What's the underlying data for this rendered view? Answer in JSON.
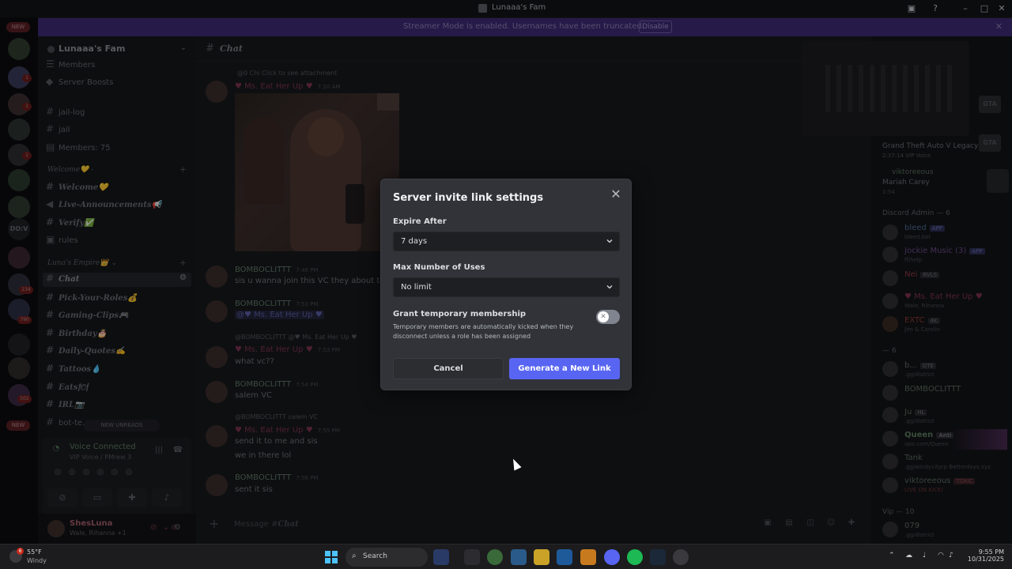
{
  "window": {
    "title": "Lunaaa's Fam"
  },
  "banner": {
    "text": "Streamer Mode is enabled. Usernames have been truncated.",
    "disable_label": "Disable"
  },
  "rail": {
    "new_top": "NEW",
    "new_bottom": "NEW",
    "badges": [
      "1",
      "1",
      "1",
      "234",
      "790",
      "502",
      "1"
    ],
    "dov_label": "DO:V"
  },
  "sidebar": {
    "guild_name": "Lunaaa's Fam",
    "items_top": [
      {
        "label": "Members"
      },
      {
        "label": "Server Boosts"
      }
    ],
    "channels_a": [
      "jail-log",
      "jail",
      "Members: 75"
    ],
    "category_welcome": "Welcome💛 -",
    "channels_welcome": [
      "Welcome💛",
      "Live-Announcements📢",
      "Verify✅",
      "rules"
    ],
    "category_empire": "Luna's Empire👑 ⌄",
    "active_channel": "Chat",
    "channels_empire": [
      "Pick-Your-Roles💰",
      "Gaming-Clips🎮",
      "Birthday🎂",
      "Daily-Quotes✍",
      "Tattoos💧",
      "Eats🍽",
      "IRL📷",
      "bot-te..."
    ],
    "new_unreads": "NEW UNREADS"
  },
  "voice": {
    "status": "Voice Connected",
    "channel": "VIP Voice / PMrew 3"
  },
  "user": {
    "name": "ShesLuna",
    "sub": "Wale, Rihanna +1"
  },
  "chat": {
    "channel": "Chat",
    "msg1_reply": "@0  Chi  Click to see attachment",
    "msg1_author": "♥ Ms. Eat Her Up ♥",
    "msg1_time": "7:20 AM",
    "msg2_author": "BOMBOCLITTT",
    "msg2_time": "7:46 PM",
    "msg2_text": "sis u wanna join this VC they about to dri",
    "msg3_author": "BOMBOCLITTT",
    "msg3_time": "7:53 PM",
    "msg3_mention": "@♥ Ms. Eat Her Up ♥",
    "msg4_reply": "@BOMBOCLITTT  @♥ Ms. Eat Her Up ♥",
    "msg4_author": "♥ Ms. Eat Her Up ♥",
    "msg4_time": "7:53 PM",
    "msg4_text": "what vc??",
    "msg5_author": "BOMBOCLITTT",
    "msg5_time": "7:54 PM",
    "msg5_text": "salem VC",
    "msg6_reply": "@BOMBOCLITTT  salem VC",
    "msg6_author": "♥ Ms. Eat Her Up ♥",
    "msg6_time": "7:55 PM",
    "msg6_text1": "send it to me and sis",
    "msg6_text2": "we in there lol",
    "msg7_author": "BOMBOCLITTT",
    "msg7_time": "7:56 PM",
    "msg7_text": "sent it sis",
    "composer_prefix": "Message #",
    "composer_channel": "Chat"
  },
  "members": {
    "game1": "Grand Theft Auto V Legacy",
    "game1_sub": "2:37:14  VIP Voice",
    "viktor1": "viktoreeous",
    "viktor1_sub": "Mariah Carey",
    "viktor1_time": "1:54",
    "admin_header": "Discord Admin — 6",
    "admins": [
      {
        "name": "bleed",
        "tag": "APP",
        "sub": "bleed.bot"
      },
      {
        "name": "Jockie Music (3)",
        "tag": "APP",
        "sub": "ff/help"
      },
      {
        "name": "Nei",
        "tag": "RVLS",
        "sub": ""
      },
      {
        "name": "♥ Ms. Eat Her Up ♥",
        "tag": "",
        "sub": "Wale, Rihanna"
      },
      {
        "name": "EXTC",
        "tag": "4K",
        "sub": "Jim & Carolin"
      }
    ],
    "other_header": "— 6",
    "others": [
      {
        "name": "b...",
        "tag": "DTE",
        "sub": ".gg/district"
      },
      {
        "name": "BOMBOCLITTT",
        "tag": "",
        "sub": ""
      },
      {
        "name": "Ju",
        "tag": "HL",
        "sub": ".gg/district"
      },
      {
        "name": "Queen",
        "tag": "Anti",
        "sub": "ope.com/Queen"
      },
      {
        "name": "Tank",
        "tag": "",
        "sub": ".gg/windycityrp Betterdays.xyz"
      },
      {
        "name": "viktoreeous",
        "tag": "TOXIC",
        "sub": "LIVE ON KICK!"
      }
    ],
    "vip_header": "Vip — 10",
    "vip1": "079",
    "vip1_sub": ".gg/district"
  },
  "modal": {
    "title": "Server invite link settings",
    "expire_label": "Expire After",
    "expire_value": "7 days",
    "max_uses_label": "Max Number of Uses",
    "max_uses_value": "No limit",
    "temp_title": "Grant temporary membership",
    "temp_desc": "Temporary members are automatically kicked when they disconnect unless a role has been assigned",
    "temp_enabled": false,
    "cancel_label": "Cancel",
    "generate_label": "Generate a New Link"
  },
  "taskbar": {
    "temp": "55°F",
    "condition": "Windy",
    "weather_badge": "6",
    "search_label": "Search",
    "time": "9:55 PM",
    "date": "10/31/2025"
  },
  "colors": {
    "accent": "#5865f2",
    "modal_bg": "#313338",
    "banner": "#3d2a75"
  }
}
